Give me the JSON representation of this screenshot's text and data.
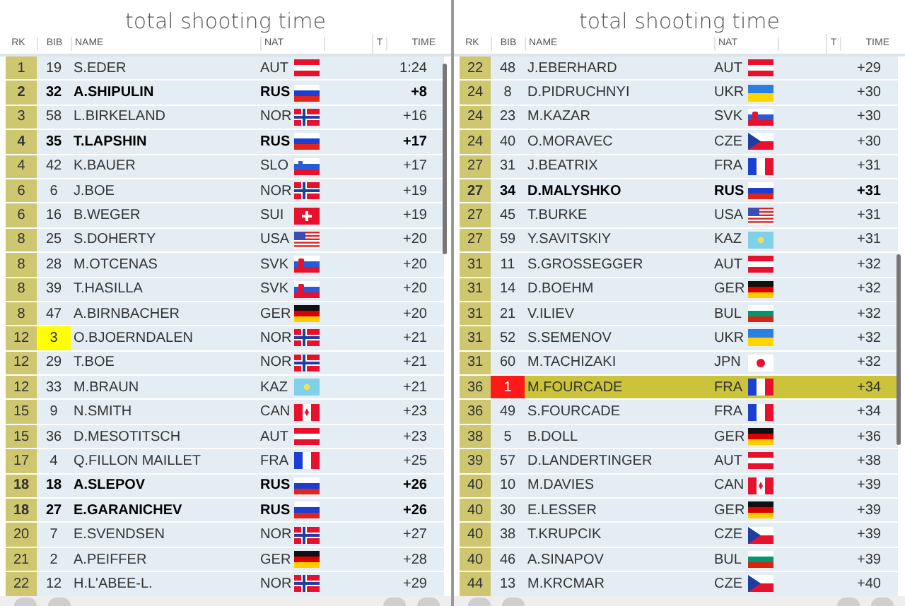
{
  "panels": [
    {
      "title": "total shooting time",
      "columns": [
        "RK",
        "BIB",
        "NAME",
        "NAT",
        "T",
        "TIME"
      ],
      "rows": [
        {
          "rank": "1",
          "bib": "19",
          "name": "S.EDER",
          "nat": "AUT",
          "kind": "aut",
          "time": "1:24",
          "bold": false,
          "selected": false
        },
        {
          "rank": "2",
          "bib": "32",
          "name": "A.SHIPULIN",
          "nat": "RUS",
          "kind": "rus",
          "time": "+8",
          "bold": true,
          "selected": false
        },
        {
          "rank": "3",
          "bib": "58",
          "name": "L.BIRKELAND",
          "nat": "NOR",
          "kind": "nor",
          "time": "+16",
          "bold": false,
          "selected": false
        },
        {
          "rank": "4",
          "bib": "35",
          "name": "T.LAPSHIN",
          "nat": "RUS",
          "kind": "rus",
          "time": "+17",
          "bold": true,
          "selected": false
        },
        {
          "rank": "4",
          "bib": "42",
          "name": "K.BAUER",
          "nat": "SLO",
          "kind": "slo",
          "time": "+17",
          "bold": false,
          "selected": false
        },
        {
          "rank": "6",
          "bib": "6",
          "name": "J.BOE",
          "nat": "NOR",
          "kind": "nor",
          "time": "+19",
          "bold": false,
          "selected": false
        },
        {
          "rank": "6",
          "bib": "16",
          "name": "B.WEGER",
          "nat": "SUI",
          "kind": "sui",
          "time": "+19",
          "bold": false,
          "selected": false
        },
        {
          "rank": "8",
          "bib": "25",
          "name": "S.DOHERTY",
          "nat": "USA",
          "kind": "usa",
          "time": "+20",
          "bold": false,
          "selected": false
        },
        {
          "rank": "8",
          "bib": "28",
          "name": "M.OTCENAS",
          "nat": "SVK",
          "kind": "svk",
          "time": "+20",
          "bold": false,
          "selected": false
        },
        {
          "rank": "8",
          "bib": "39",
          "name": "T.HASILLA",
          "nat": "SVK",
          "kind": "svk",
          "time": "+20",
          "bold": false,
          "selected": false
        },
        {
          "rank": "8",
          "bib": "47",
          "name": "A.BIRNBACHER",
          "nat": "GER",
          "kind": "ger",
          "time": "+20",
          "bold": false,
          "selected": false
        },
        {
          "rank": "12",
          "bib": "3",
          "name": "O.BJOERNDALEN",
          "nat": "NOR",
          "kind": "nor",
          "time": "+21",
          "bold": false,
          "selected": false,
          "color": "#ffff00"
        },
        {
          "rank": "12",
          "bib": "29",
          "name": "T.BOE",
          "nat": "NOR",
          "kind": "nor",
          "time": "+21",
          "bold": false,
          "selected": false
        },
        {
          "rank": "12",
          "bib": "33",
          "name": "M.BRAUN",
          "nat": "KAZ",
          "kind": "kaz",
          "time": "+21",
          "bold": false,
          "selected": false
        },
        {
          "rank": "15",
          "bib": "9",
          "name": "N.SMITH",
          "nat": "CAN",
          "kind": "can",
          "time": "+23",
          "bold": false,
          "selected": false
        },
        {
          "rank": "15",
          "bib": "36",
          "name": "D.MESOTITSCH",
          "nat": "AUT",
          "kind": "aut",
          "time": "+23",
          "bold": false,
          "selected": false
        },
        {
          "rank": "17",
          "bib": "4",
          "name": "Q.FILLON MAILLET",
          "nat": "FRA",
          "kind": "fra",
          "time": "+25",
          "bold": false,
          "selected": false
        },
        {
          "rank": "18",
          "bib": "18",
          "name": "A.SLEPOV",
          "nat": "RUS",
          "kind": "rus",
          "time": "+26",
          "bold": true,
          "selected": false
        },
        {
          "rank": "18",
          "bib": "27",
          "name": "E.GARANICHEV",
          "nat": "RUS",
          "kind": "rus",
          "time": "+26",
          "bold": true,
          "selected": false
        },
        {
          "rank": "20",
          "bib": "7",
          "name": "E.SVENDSEN",
          "nat": "NOR",
          "kind": "nor",
          "time": "+27",
          "bold": false,
          "selected": false
        },
        {
          "rank": "21",
          "bib": "2",
          "name": "A.PEIFFER",
          "nat": "GER",
          "kind": "ger",
          "time": "+28",
          "bold": false,
          "selected": false
        },
        {
          "rank": "22",
          "bib": "12",
          "name": "H.L'ABEE-L.",
          "nat": "NOR",
          "kind": "nor",
          "time": "+29",
          "bold": false,
          "selected": false
        }
      ]
    },
    {
      "title": "total shooting time",
      "columns": [
        "RK",
        "BIB",
        "NAME",
        "NAT",
        "T",
        "TIME"
      ],
      "rows": [
        {
          "rank": "22",
          "bib": "48",
          "name": "J.EBERHARD",
          "nat": "AUT",
          "kind": "aut",
          "time": "+29",
          "bold": false,
          "selected": false
        },
        {
          "rank": "24",
          "bib": "8",
          "name": "D.PIDRUCHNYI",
          "nat": "UKR",
          "kind": "ukr",
          "time": "+30",
          "bold": false,
          "selected": false
        },
        {
          "rank": "24",
          "bib": "23",
          "name": "M.KAZAR",
          "nat": "SVK",
          "kind": "svk",
          "time": "+30",
          "bold": false,
          "selected": false
        },
        {
          "rank": "24",
          "bib": "40",
          "name": "O.MORAVEC",
          "nat": "CZE",
          "kind": "cze",
          "time": "+30",
          "bold": false,
          "selected": false
        },
        {
          "rank": "27",
          "bib": "31",
          "name": "J.BEATRIX",
          "nat": "FRA",
          "kind": "fra",
          "time": "+31",
          "bold": false,
          "selected": false
        },
        {
          "rank": "27",
          "bib": "34",
          "name": "D.MALYSHKO",
          "nat": "RUS",
          "kind": "rus",
          "time": "+31",
          "bold": true,
          "selected": false
        },
        {
          "rank": "27",
          "bib": "45",
          "name": "T.BURKE",
          "nat": "USA",
          "kind": "usa",
          "time": "+31",
          "bold": false,
          "selected": false
        },
        {
          "rank": "27",
          "bib": "59",
          "name": "Y.SAVITSKIY",
          "nat": "KAZ",
          "kind": "kaz",
          "time": "+31",
          "bold": false,
          "selected": false
        },
        {
          "rank": "31",
          "bib": "11",
          "name": "S.GROSSEGGER",
          "nat": "AUT",
          "kind": "aut",
          "time": "+32",
          "bold": false,
          "selected": false
        },
        {
          "rank": "31",
          "bib": "14",
          "name": "D.BOEHM",
          "nat": "GER",
          "kind": "ger",
          "time": "+32",
          "bold": false,
          "selected": false
        },
        {
          "rank": "31",
          "bib": "21",
          "name": "V.ILIEV",
          "nat": "BUL",
          "kind": "bul",
          "time": "+32",
          "bold": false,
          "selected": false
        },
        {
          "rank": "31",
          "bib": "52",
          "name": "S.SEMENOV",
          "nat": "UKR",
          "kind": "ukr",
          "time": "+32",
          "bold": false,
          "selected": false
        },
        {
          "rank": "31",
          "bib": "60",
          "name": "M.TACHIZAKI",
          "nat": "JPN",
          "kind": "jpn",
          "time": "+32",
          "bold": false,
          "selected": false
        },
        {
          "rank": "36",
          "bib": "1",
          "name": "M.FOURCADE",
          "nat": "FRA",
          "kind": "fra",
          "time": "+34",
          "bold": false,
          "selected": true,
          "color": "#ff1a1a"
        },
        {
          "rank": "36",
          "bib": "49",
          "name": "S.FOURCADE",
          "nat": "FRA",
          "kind": "fra",
          "time": "+34",
          "bold": false,
          "selected": false
        },
        {
          "rank": "38",
          "bib": "5",
          "name": "B.DOLL",
          "nat": "GER",
          "kind": "ger",
          "time": "+36",
          "bold": false,
          "selected": false
        },
        {
          "rank": "39",
          "bib": "57",
          "name": "D.LANDERTINGER",
          "nat": "AUT",
          "kind": "aut",
          "time": "+38",
          "bold": false,
          "selected": false
        },
        {
          "rank": "40",
          "bib": "10",
          "name": "M.DAVIES",
          "nat": "CAN",
          "kind": "can",
          "time": "+39",
          "bold": false,
          "selected": false
        },
        {
          "rank": "40",
          "bib": "30",
          "name": "E.LESSER",
          "nat": "GER",
          "kind": "ger",
          "time": "+39",
          "bold": false,
          "selected": false
        },
        {
          "rank": "40",
          "bib": "38",
          "name": "T.KRUPCIK",
          "nat": "CZE",
          "kind": "cze",
          "time": "+39",
          "bold": false,
          "selected": false
        },
        {
          "rank": "40",
          "bib": "46",
          "name": "A.SINAPOV",
          "nat": "BUL",
          "kind": "bul",
          "time": "+39",
          "bold": false,
          "selected": false
        },
        {
          "rank": "44",
          "bib": "13",
          "name": "M.KRCMAR",
          "nat": "CZE",
          "kind": "cze",
          "time": "+40",
          "bold": false,
          "selected": false
        }
      ]
    }
  ]
}
